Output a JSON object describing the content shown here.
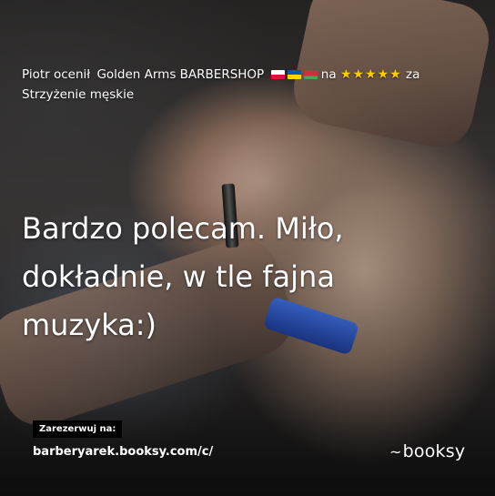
{
  "review": {
    "reviewer": "Piotr",
    "action": "ocenił",
    "business": "Golden Arms BARBERSHOP",
    "rated_on": "na",
    "stars_icon": "★★★★★",
    "rating": 5,
    "for_word": "za",
    "service": "Strzyżenie męskie",
    "flags": [
      "poland-flag-icon",
      "ukraine-flag-icon",
      "belarus-flag-icon"
    ]
  },
  "quote": {
    "line1": "Bardzo polecam. Miło,",
    "line2": "dokładnie, w tle fajna",
    "line3": "muzyka:)"
  },
  "booking": {
    "label": "Zarezerwuj na:",
    "url": "barberyarek.booksy.com/c/"
  },
  "brand": {
    "logo_mark": "~",
    "name": "booksy"
  },
  "colors": {
    "star": "#ffcc00",
    "text": "#ffffff",
    "label_bg": "#000000"
  }
}
